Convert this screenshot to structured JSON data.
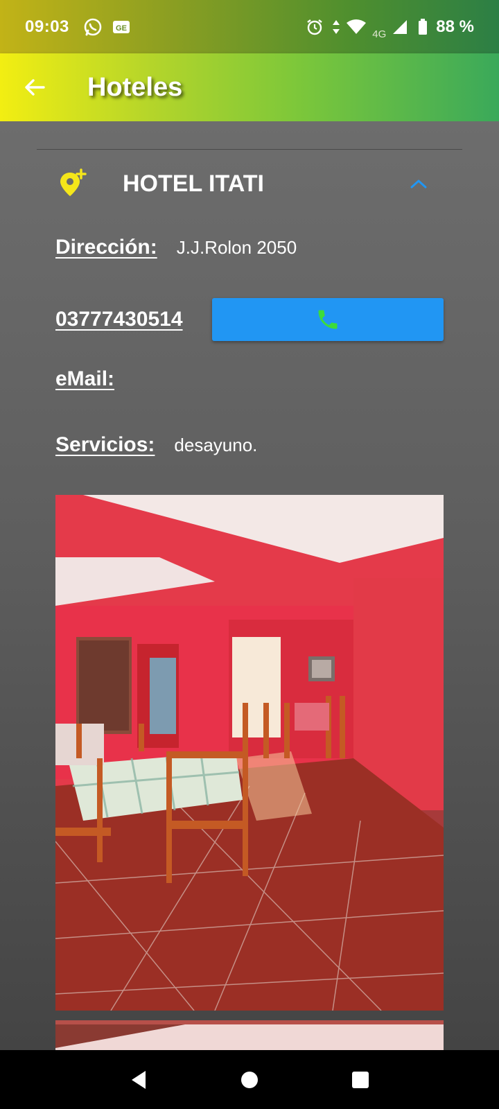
{
  "status_bar": {
    "time": "09:03",
    "network": "4G",
    "battery": "88 %",
    "icons": [
      "whatsapp-icon",
      "ge-icon",
      "alarm-icon",
      "data-arrows-icon",
      "wifi-icon",
      "signal-icon",
      "battery-icon"
    ]
  },
  "app_bar": {
    "title": "Hoteles",
    "back_icon": "arrow-back-icon"
  },
  "hotel": {
    "name": "HOTEL ITATI",
    "pin_icon": "add-location-icon",
    "expand_icon": "chevron-up-icon",
    "address_label": "Dirección:",
    "address_value": "J.J.Rolon 2050",
    "phone": "03777430514",
    "call_icon": "phone-icon",
    "email_label": "eMail:",
    "email_value": "",
    "services_label": "Servicios:",
    "services_value": "desayuno."
  },
  "colors": {
    "accent_blue": "#2196f3",
    "pin_yellow": "#f5e61a",
    "phone_green": "#3ddc3a",
    "gradient_start": "#f2ee12",
    "gradient_end": "#3aa95a"
  },
  "nav_bar": {
    "back": "nav-back-icon",
    "home": "nav-home-icon",
    "recents": "nav-recents-icon"
  }
}
